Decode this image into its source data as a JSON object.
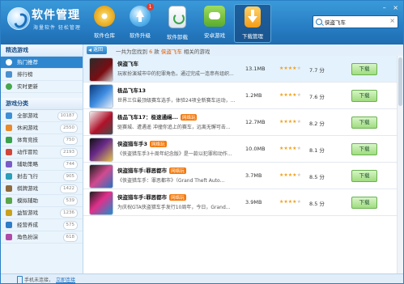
{
  "app": {
    "title": "软件管理",
    "slogan": "海量软件 轻松管理"
  },
  "toolbar": [
    {
      "label": "软件仓库",
      "icon": "disc-icon",
      "color": "#f4c33a"
    },
    {
      "label": "软件升级",
      "icon": "upgrade-icon",
      "color": "#3fa6e8",
      "badge": "1"
    },
    {
      "label": "软件卸载",
      "icon": "recycle-bin-icon",
      "color": "#49b655"
    },
    {
      "label": "安卓游戏",
      "icon": "android-game-icon",
      "color": "#7cc44a"
    },
    {
      "label": "下载管理",
      "icon": "download-icon",
      "color": "#f3a326"
    }
  ],
  "window_controls": {
    "minimize": "–",
    "close": "×"
  },
  "search": {
    "value": "侠盗飞车",
    "clear": "×"
  },
  "sidebar": {
    "section1_title": "精选游戏",
    "section1_items": [
      {
        "label": "热门推荐",
        "icon": "hot-icon",
        "selected": true
      },
      {
        "label": "排行榜",
        "icon": "ranking-icon"
      },
      {
        "label": "实时更新",
        "icon": "refresh-icon"
      }
    ],
    "section2_title": "游戏分类",
    "section2_items": [
      {
        "label": "全部游戏",
        "count": "10187"
      },
      {
        "label": "休闲游戏",
        "count": "2550"
      },
      {
        "label": "体育竞技",
        "count": "750"
      },
      {
        "label": "动作冒险",
        "count": "2193"
      },
      {
        "label": "辅助策略",
        "count": "744"
      },
      {
        "label": "射击飞行",
        "count": "905"
      },
      {
        "label": "棋牌游戏",
        "count": "1422"
      },
      {
        "label": "模拟辅助",
        "count": "539"
      },
      {
        "label": "益智游戏",
        "count": "1236"
      },
      {
        "label": "经营养成",
        "count": "575"
      },
      {
        "label": "角色扮演",
        "count": "618"
      }
    ]
  },
  "results": {
    "back_label": "返回",
    "text_prefix": "一共为您找到 ",
    "count": "6",
    "text_middle": " 款 ",
    "keyword": "侠盗飞车",
    "text_suffix": " 相关的游戏"
  },
  "games": [
    {
      "name": "侠盗飞车",
      "tag": "",
      "desc": "玩家扮演城市中的犯罪角色，通过完成一连串有组织...",
      "size": "13.1MB",
      "rating": 4,
      "score": "7.7 分",
      "button": "下载"
    },
    {
      "name": "极品飞车13",
      "tag": "",
      "desc": "世界三位最顶级赛车选手，体验24项全新赛车运动，...",
      "size": "1.2MB",
      "rating": 4,
      "score": "7.6 分",
      "button": "下载"
    },
    {
      "name": "极品飞车17：极速通缉...",
      "tag": "网络玩",
      "desc": "驱赛城、遭遇遥 冲撞你追上的赛车，远离无懈可击...",
      "size": "12.7MB",
      "rating": 4,
      "score": "8.2 分",
      "button": "下载"
    },
    {
      "name": "侠盗猎车手3",
      "tag": "网络玩",
      "desc": "《侠盗猎车手3十周年纪念版》是一款以犯罪和动作...",
      "size": "10.0MB",
      "rating": 4,
      "score": "8.1 分",
      "button": "下载"
    },
    {
      "name": "侠盗猎车手:罪恶都市",
      "tag": "网络玩",
      "desc": "《侠盗猎车手：罪恶都市》（Grand Theft Auto...",
      "size": "3.7MB",
      "rating": 4,
      "score": "8.5 分",
      "button": "下载"
    },
    {
      "name": "侠盗猎车手:罪恶都市",
      "tag": "网络玩",
      "desc": "为庆祝GTA侠盗猎车手发行10周年，今日，Grand...",
      "size": "3.9MB",
      "rating": 4,
      "score": "8.5 分",
      "button": "下载"
    }
  ],
  "status": {
    "text": "手机未连接，",
    "link": "立即连接"
  }
}
